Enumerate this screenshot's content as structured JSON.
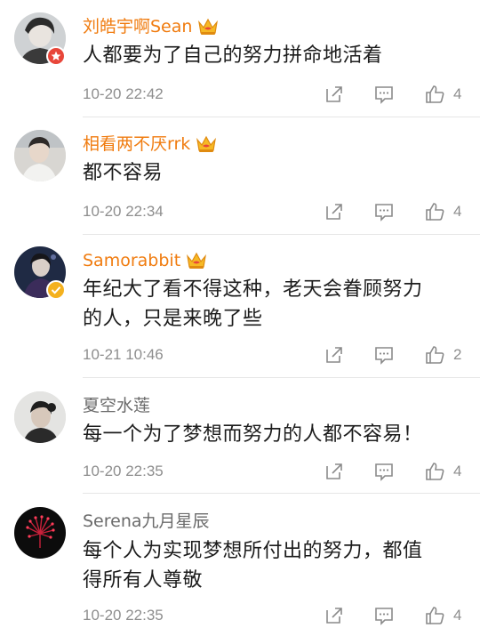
{
  "comments": [
    {
      "username": "刘皓宇啊Sean",
      "content": "人都要为了自己的努力拼命地活着",
      "timestamp": "10-20 22:42",
      "likes": "4"
    },
    {
      "username": "相看两不厌rrk",
      "content": "都不容易",
      "timestamp": "10-20 22:34",
      "likes": "4"
    },
    {
      "username": "Samorabbit",
      "content_line1": "年纪大了看不得这种，老天会眷顾努力",
      "content_line2": "的人，只是来晚了些",
      "timestamp": "10-21 10:46",
      "likes": "2"
    },
    {
      "username": "夏空水莲",
      "content": "每一个为了梦想而努力的人都不容易！",
      "timestamp": "10-20 22:35",
      "likes": "4"
    },
    {
      "username": "Serena九月星辰",
      "content_line1": "每个人为实现梦想所付出的努力，都值",
      "content_line2": "得所有人尊敬",
      "timestamp": "10-20 22:35",
      "likes": "4"
    }
  ],
  "icons": {
    "share": "share-icon",
    "reply": "comment-icon",
    "like": "thumbs-up-icon",
    "crown": "crown-icon"
  },
  "colors": {
    "vip_username": "#f07c10",
    "plain_username": "#6b6b6b",
    "meta_text": "#8e8e8e",
    "icon_stroke": "#8a8a8a"
  }
}
